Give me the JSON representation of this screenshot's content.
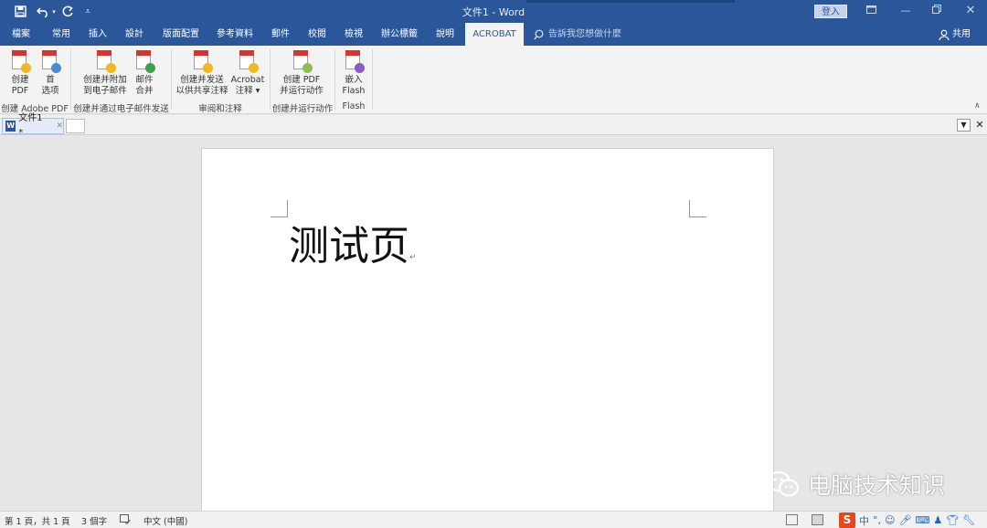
{
  "titlebar": {
    "title": "文件1 - Word",
    "signin_label": "登入",
    "quick_access": [
      "save-icon",
      "undo-icon",
      "redo-icon",
      "customize-icon"
    ]
  },
  "tabs": {
    "items": [
      "檔案",
      "常用",
      "插入",
      "設計",
      "版面配置",
      "參考資料",
      "郵件",
      "校閱",
      "檢視",
      "辦公標籤",
      "說明",
      "ACROBAT"
    ],
    "active": "ACROBAT",
    "tell_me": "告訴我您想做什麼",
    "share": "共用"
  },
  "ribbon": {
    "buttons": [
      {
        "line1": "创建",
        "line2": "PDF"
      },
      {
        "line1": "首",
        "line2": "选项"
      },
      {
        "line1": "创建并附加",
        "line2": "到电子邮件"
      },
      {
        "line1": "邮件",
        "line2": "合并"
      },
      {
        "line1": "创建并发送",
        "line2": "以供共享注释"
      },
      {
        "line1": "Acrobat",
        "line2": "注释 ▾"
      },
      {
        "line1": "创建 PDF",
        "line2": "并运行动作"
      },
      {
        "line1": "嵌入",
        "line2": "Flash"
      }
    ],
    "groups": [
      "创建 Adobe PDF",
      "创建并通过电子邮件发送",
      "审阅和注释",
      "创建并运行动作",
      "Flash"
    ],
    "badge_colors": [
      "#f1b81f",
      "#4a8bd6",
      "#f1b81f",
      "#3ca34a",
      "#f1b81f",
      "#f1b81f",
      "#8fbf4c",
      "#8a5cc7"
    ]
  },
  "doc_tab": {
    "label": "文件1 *"
  },
  "document": {
    "body_text": "测试页",
    "paragraph_mark": "↵"
  },
  "watermark": {
    "text": "电脑技术知识"
  },
  "statusbar": {
    "page": "第 1 頁，共 1 頁",
    "words": "3 個字",
    "language": "中文 (中國)",
    "ime_mode": "中"
  },
  "colors": {
    "accent": "#2b579a",
    "ribbon_bg": "#f3f3f3",
    "pdf_red": "#d9332b"
  }
}
